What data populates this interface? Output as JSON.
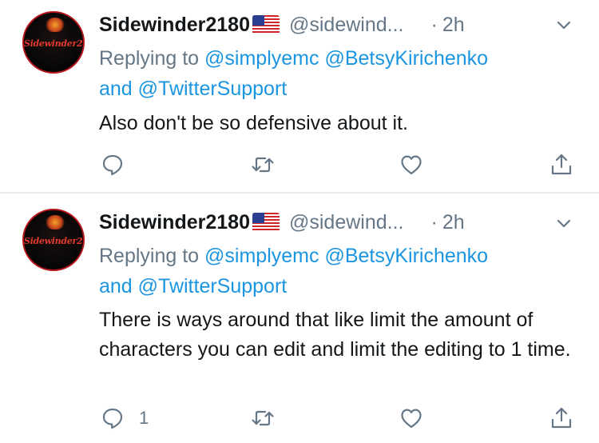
{
  "tweets": [
    {
      "avatar_text": "Sidewinder2180",
      "display_name": "Sidewinder2180",
      "handle": "@sidewind...",
      "separator": "·",
      "time": "2h",
      "replying_prefix": "Replying to",
      "mention_1": "@simplyemc",
      "mention_2": "@BetsyKirichenko",
      "joiner": "and",
      "mention_3": "@TwitterSupport",
      "text": "Also don't be so defensive about it.",
      "reply_count": ""
    },
    {
      "avatar_text": "Sidewinder2180",
      "display_name": "Sidewinder2180",
      "handle": "@sidewind...",
      "separator": "·",
      "time": "2h",
      "replying_prefix": "Replying to",
      "mention_1": "@simplyemc",
      "mention_2": "@BetsyKirichenko",
      "joiner": "and",
      "mention_3": "@TwitterSupport",
      "text": "There is ways around that like limit the amount of characters you can edit and limit the editing to 1 time.",
      "reply_count": "1"
    }
  ],
  "icons": {
    "more": "chevron-down-icon",
    "reply": "reply-icon",
    "retweet": "retweet-icon",
    "like": "heart-icon",
    "share": "share-icon",
    "flag": "us-flag-icon"
  },
  "colors": {
    "link": "#1b95e0",
    "secondary_text": "#657786",
    "primary_text": "#14171a",
    "divider": "#e6ecf0"
  }
}
